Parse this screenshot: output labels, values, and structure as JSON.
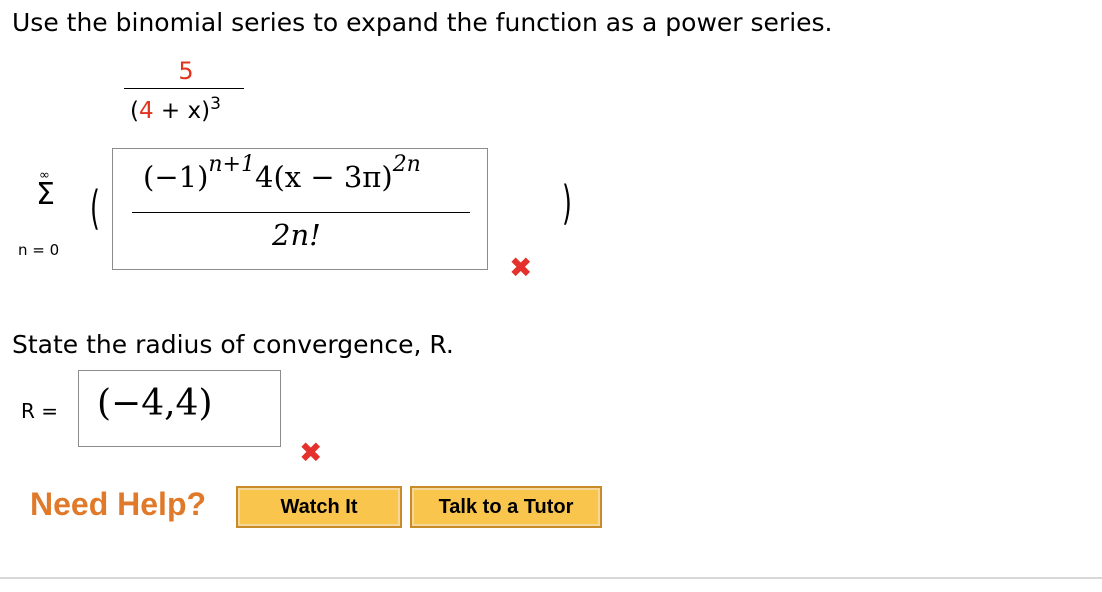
{
  "question": {
    "prompt": "Use the binomial series to expand the function as a power series.",
    "function": {
      "numerator": "5",
      "denominator_base": "4",
      "denominator_rest": " + x)",
      "denominator_open": "(",
      "denominator_exponent": "3"
    }
  },
  "series": {
    "upper_limit": "∞",
    "sigma": "Σ",
    "lower_limit": "n = 0",
    "open_paren": "(",
    "close_paren": ")",
    "answer": {
      "numerator_main": "(−1)",
      "numerator_exp1": "n+1",
      "numerator_mid": "4(x − 3π)",
      "numerator_exp2": "2n",
      "denominator": "2n!"
    },
    "status": "incorrect"
  },
  "radius": {
    "prompt": "State the radius of convergence, R.",
    "label": "R =",
    "answer": "(−4,4)",
    "status": "incorrect"
  },
  "help": {
    "label": "Need Help?",
    "watch_button": "Watch It",
    "tutor_button": "Talk to a Tutor"
  },
  "icons": {
    "incorrect": "close-x-icon"
  },
  "colors": {
    "accent_red": "#e0341e",
    "help_orange": "#e07a2a",
    "button_fill": "#f9c54d"
  }
}
